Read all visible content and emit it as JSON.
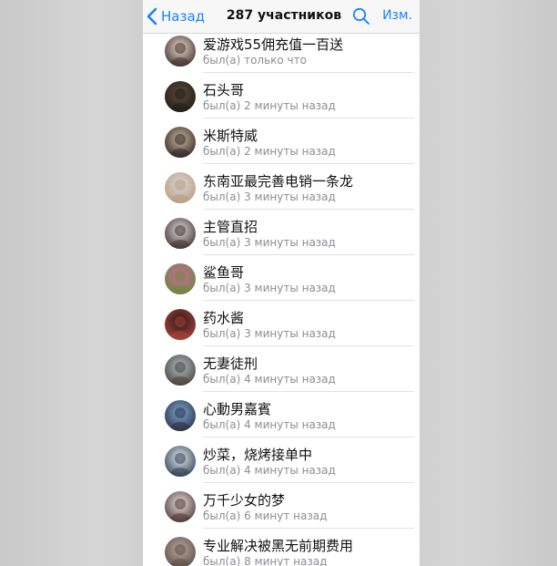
{
  "nav": {
    "back_label": "Назад",
    "title": "287 участников",
    "edit_label": "Изм.",
    "accent": "#1a82fb"
  },
  "members": [
    {
      "name": "爱游戏55佣充值一百送",
      "status": "был(а) только что",
      "avatar_colors": [
        "#e8d6cc",
        "#3a2a26"
      ]
    },
    {
      "name": "石头哥",
      "status": "был(а) 2 минуты назад",
      "avatar_colors": [
        "#5a4a3a",
        "#1f1a16"
      ]
    },
    {
      "name": "米斯特威",
      "status": "был(а) 2 минуты назад",
      "avatar_colors": [
        "#c9b79c",
        "#2a2220"
      ]
    },
    {
      "name": "东南亚最完善电销一条龙",
      "status": "был(а) 3 минуты назад",
      "avatar_colors": [
        "#d8d8d4",
        "#b89a80"
      ]
    },
    {
      "name": "主管直招",
      "status": "был(а) 3 минуты назад",
      "avatar_colors": [
        "#ded8d4",
        "#3a2c2a"
      ]
    },
    {
      "name": "鲨鱼哥",
      "status": "был(а) 3 минуты назад",
      "avatar_colors": [
        "#c86a9a",
        "#6a8a3a"
      ]
    },
    {
      "name": "药水酱",
      "status": "был(а) 3 минуты назад",
      "avatar_colors": [
        "#2a1a1a",
        "#b0443a"
      ]
    },
    {
      "name": "无妻徒刑",
      "status": "был(а) 4 минуты назад",
      "avatar_colors": [
        "#a8c0c8",
        "#4a3a30"
      ]
    },
    {
      "name": "心動男嘉賓",
      "status": "был(а) 4 минуты назад",
      "avatar_colors": [
        "#7aa8d8",
        "#2a2a3a"
      ]
    },
    {
      "name": "炒菜，烧烤接单中",
      "status": "был(а) 4 минуты назад",
      "avatar_colors": [
        "#e0e8f0",
        "#2a3a4a"
      ]
    },
    {
      "name": "万千少女的梦",
      "status": "был(а) 6 минут назад",
      "avatar_colors": [
        "#e8e0dc",
        "#4a3030"
      ]
    },
    {
      "name": "专业解决被黑无前期费用",
      "status": "был(а) 8 минут назад",
      "avatar_colors": [
        "#b8a8a0",
        "#5a4a40"
      ]
    }
  ]
}
